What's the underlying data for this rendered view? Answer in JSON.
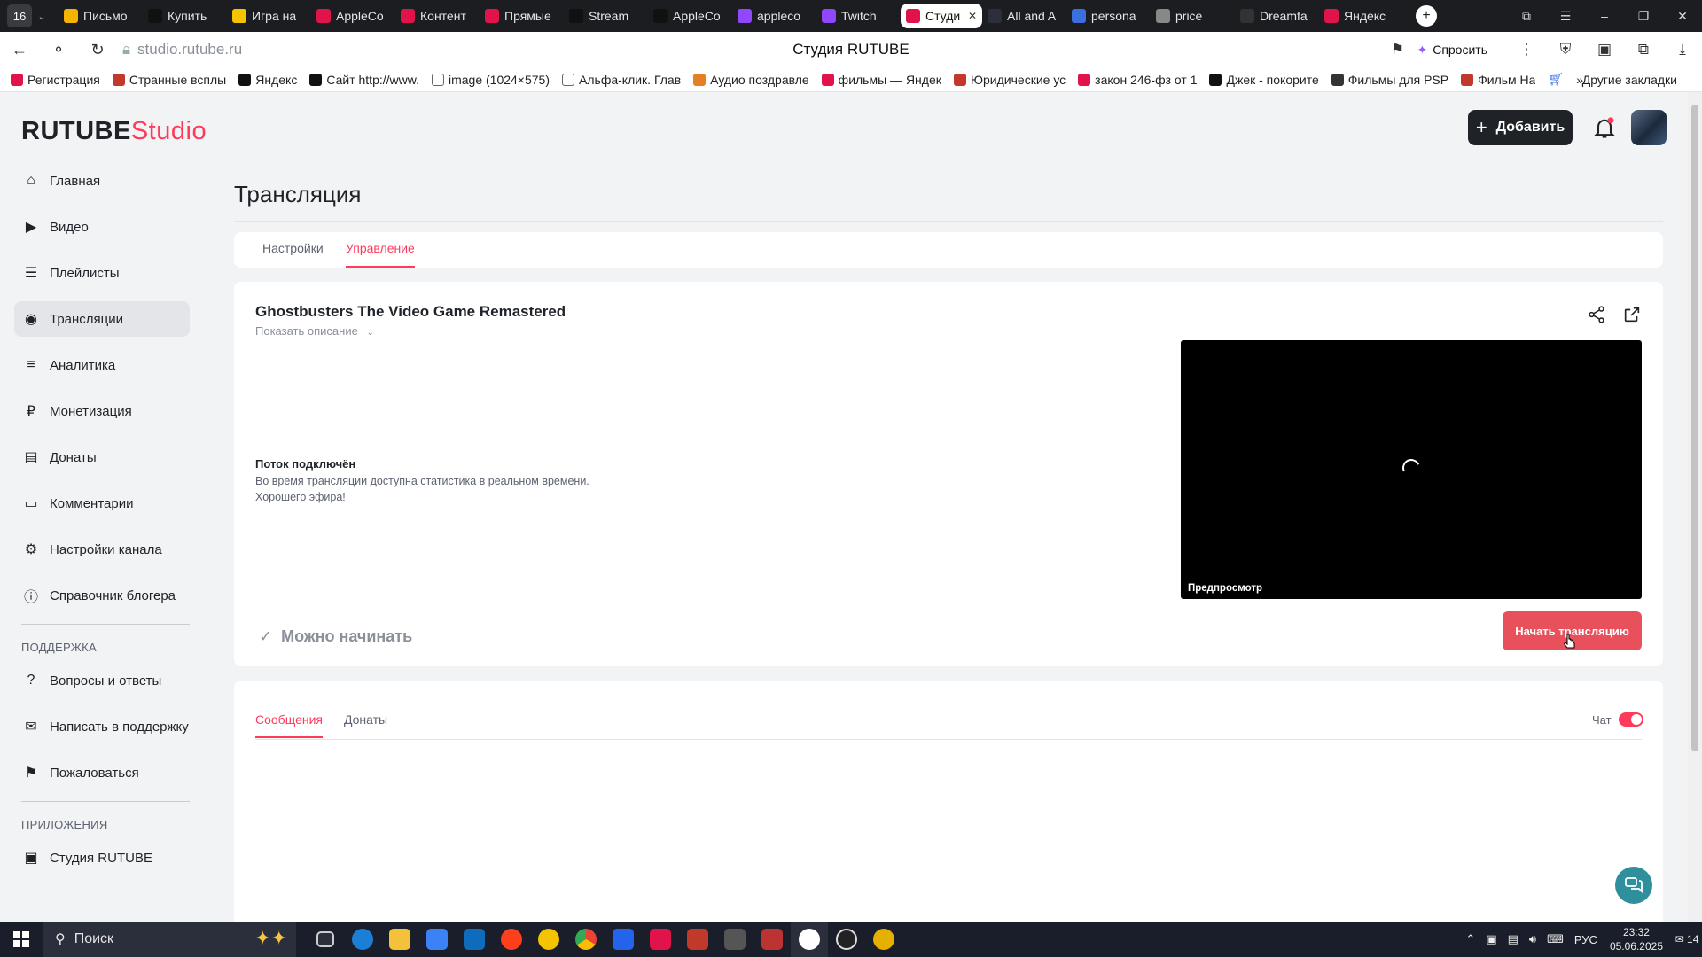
{
  "browser": {
    "tab_count": "16",
    "tabs": [
      {
        "label": "Письмо",
        "color": "#f5b400"
      },
      {
        "label": "Купить",
        "color": "#111111"
      },
      {
        "label": "Игра на",
        "color": "#f5c400"
      },
      {
        "label": "AppleCo",
        "color": "#e0134a"
      },
      {
        "label": "Контент",
        "color": "#e0134a"
      },
      {
        "label": "Прямые",
        "color": "#e0134a"
      },
      {
        "label": "Stream",
        "color": "#111111"
      },
      {
        "label": "AppleCo",
        "color": "#111111"
      },
      {
        "label": "appleco",
        "color": "#9146ff"
      },
      {
        "label": "Twitch",
        "color": "#9146ff"
      },
      {
        "label": "Студи",
        "color": "#e0134a"
      },
      {
        "label": "All and A",
        "color": "#2b2f3b"
      },
      {
        "label": "persona",
        "color": "#3b6fe0"
      },
      {
        "label": "price",
        "color": "#888888"
      },
      {
        "label": "Dreamfa",
        "color": "#333333"
      },
      {
        "label": "Яндекс",
        "color": "#e0134a"
      }
    ],
    "active_tab_index": 10,
    "url": "studio.rutube.ru",
    "page_title": "Студия RUTUBE",
    "ask_label": "Спросить",
    "bookmarks": [
      {
        "label": "Регистрация",
        "color": "#e0134a"
      },
      {
        "label": "Странные всплы",
        "color": "#c0392b"
      },
      {
        "label": "Яндекс",
        "color": "#111111"
      },
      {
        "label": "Сайт http://www.",
        "color": "#111111"
      },
      {
        "label": "image (1024×575)",
        "color": "#ffffff"
      },
      {
        "label": "Альфа-клик. Глав",
        "color": "#ffffff"
      },
      {
        "label": "Аудио поздравле",
        "color": "#e67e22"
      },
      {
        "label": "фильмы — Яндек",
        "color": "#e0134a"
      },
      {
        "label": "Юридические ус",
        "color": "#c0392b"
      },
      {
        "label": "закон 246-фз от 1",
        "color": "#e0134a"
      },
      {
        "label": "Джек - покорите",
        "color": "#111111"
      },
      {
        "label": "Фильмы для PSP",
        "color": "#333333"
      },
      {
        "label": "Фильм На",
        "color": "#c0392b"
      }
    ],
    "other_bookmarks": "Другие закладки"
  },
  "studio": {
    "logo_main": "RUTUBE",
    "logo_sub": "Studio",
    "add_button": "Добавить",
    "nav": [
      {
        "label": "Главная",
        "icon": "home-icon"
      },
      {
        "label": "Видео",
        "icon": "video-icon"
      },
      {
        "label": "Плейлисты",
        "icon": "playlist-icon"
      },
      {
        "label": "Трансляции",
        "icon": "broadcast-icon"
      },
      {
        "label": "Аналитика",
        "icon": "analytics-icon"
      },
      {
        "label": "Монетизация",
        "icon": "ruble-icon"
      },
      {
        "label": "Донаты",
        "icon": "donate-icon"
      },
      {
        "label": "Комментарии",
        "icon": "comment-icon"
      },
      {
        "label": "Настройки канала",
        "icon": "gear-icon"
      },
      {
        "label": "Справочник блогера",
        "icon": "info-icon"
      }
    ],
    "support_heading": "ПОДДЕРЖКА",
    "support_items": [
      {
        "label": "Вопросы и ответы",
        "icon": "question-icon"
      },
      {
        "label": "Написать в поддержку",
        "icon": "mail-icon"
      },
      {
        "label": "Пожаловаться",
        "icon": "flag-icon"
      }
    ],
    "apps_heading": "ПРИЛОЖЕНИЯ",
    "apps_items": [
      {
        "label": "Студия RUTUBE",
        "icon": "studio-app-icon"
      }
    ],
    "page_heading": "Трансляция",
    "page_tabs": [
      "Настройки",
      "Управление"
    ],
    "active_page_tab": 1,
    "stream": {
      "title": "Ghostbusters The Video Game Remastered",
      "show_description": "Показать описание",
      "status_title": "Поток подключён",
      "status_line1": "Во время трансляции доступна статистика в реальном времени.",
      "status_line2": "Хорошего эфира!",
      "preview_label": "Предпросмотр",
      "ready_label": "Можно начинать",
      "start_button": "Начать трансляцию"
    },
    "chat": {
      "tabs": [
        "Сообщения",
        "Донаты"
      ],
      "active_tab": 0,
      "toggle_label": "Чат",
      "toggle_on": true
    }
  },
  "taskbar": {
    "search_placeholder": "Поиск",
    "language": "РУС",
    "time": "23:32",
    "date": "05.06.2025",
    "notifications": "14"
  },
  "colors": {
    "accent": "#ff3b5c",
    "start_button": "#e8505b",
    "dark": "#1f2328"
  }
}
